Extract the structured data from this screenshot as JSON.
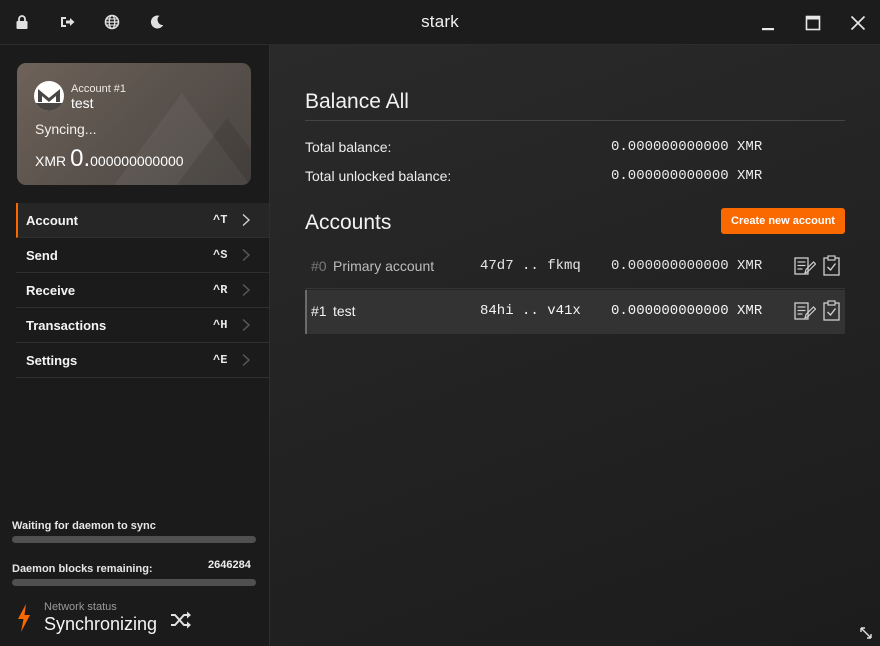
{
  "window": {
    "title": "stark"
  },
  "toolbar": {
    "icons": [
      "lock-icon",
      "sign-out-icon",
      "globe-icon",
      "moon-icon"
    ],
    "controls": [
      "minimize-icon",
      "maximize-icon",
      "close-icon"
    ]
  },
  "card": {
    "account_label": "Account #1",
    "account_name": "test",
    "status": "Syncing...",
    "currency": "XMR",
    "balance_int": "0.",
    "balance_dec": "000000000000"
  },
  "menu": {
    "items": [
      {
        "label": "Account",
        "shortcut": "^T",
        "active": true
      },
      {
        "label": "Send",
        "shortcut": "^S",
        "active": false
      },
      {
        "label": "Receive",
        "shortcut": "^R",
        "active": false
      },
      {
        "label": "Transactions",
        "shortcut": "^H",
        "active": false
      },
      {
        "label": "Settings",
        "shortcut": "^E",
        "active": false
      }
    ]
  },
  "sync": {
    "daemon_label": "Waiting for daemon to sync",
    "daemon_progress": 0.0,
    "blocks_label": "Daemon blocks remaining:",
    "blocks_value": "2646284",
    "blocks_progress": 0.0,
    "network_label": "Network status",
    "network_value": "Synchronizing"
  },
  "balance": {
    "title": "Balance All",
    "total_label": "Total balance:",
    "total_value": "0.000000000000 XMR",
    "unlocked_label": "Total unlocked balance:",
    "unlocked_value": "0.000000000000 XMR"
  },
  "accounts": {
    "title": "Accounts",
    "create_label": "Create new account",
    "rows": [
      {
        "index": "#0",
        "label": "Primary account",
        "address": "47d7 .. fkmq",
        "balance": "0.000000000000 XMR"
      },
      {
        "index": "#1",
        "label": "test",
        "address": "84hi .. v41x",
        "balance": "0.000000000000 XMR"
      }
    ]
  },
  "colors": {
    "accent": "#fa6800",
    "background": "#1b1b1b",
    "selected_row": "#333333"
  }
}
